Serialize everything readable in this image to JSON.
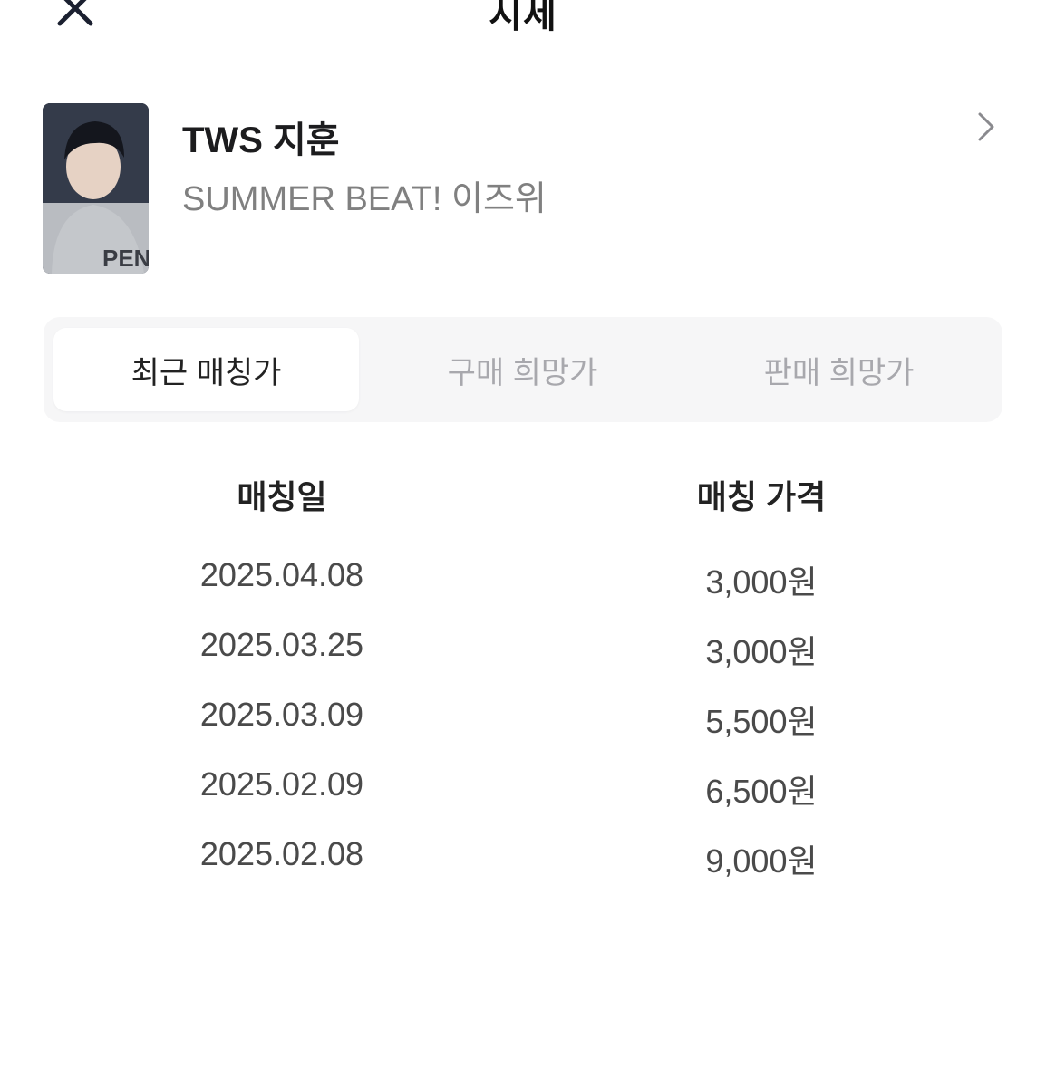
{
  "header": {
    "title": "시세",
    "close_icon": "close-icon"
  },
  "product": {
    "name": "TWS 지훈",
    "subtitle": "SUMMER BEAT! 이즈위",
    "chevron_icon": "chevron-right-icon"
  },
  "tabs": [
    {
      "label": "최근 매칭가",
      "active": true
    },
    {
      "label": "구매 희망가",
      "active": false
    },
    {
      "label": "판매 희망가",
      "active": false
    }
  ],
  "table": {
    "columns": [
      "매칭일",
      "매칭 가격"
    ],
    "rows": [
      {
        "date": "2025.04.08",
        "price": "3,000원"
      },
      {
        "date": "2025.03.25",
        "price": "3,000원"
      },
      {
        "date": "2025.03.09",
        "price": "5,500원"
      },
      {
        "date": "2025.02.09",
        "price": "6,500원"
      },
      {
        "date": "2025.02.08",
        "price": "9,000원"
      }
    ]
  }
}
